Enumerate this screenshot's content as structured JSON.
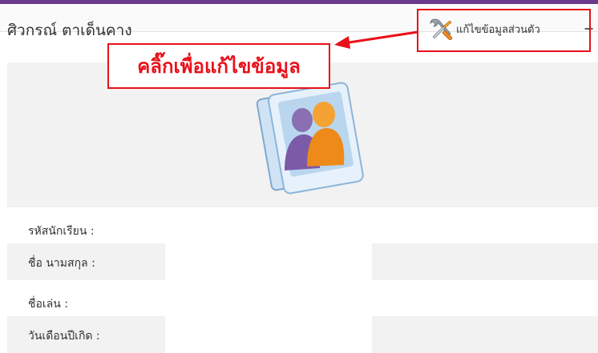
{
  "header": {
    "student_name": "ศิวกรณ์ ตาเด็นคาง",
    "edit_label": "แก้ไขข้อมูลส่วนตัว",
    "collapse_symbol": "−"
  },
  "profile": {
    "photo_icon": "user-photo-icon"
  },
  "fields": [
    {
      "label": "รหัสนักเรียน :",
      "value": ""
    },
    {
      "label": "ชื่อ นามสกุล :",
      "value": ""
    },
    {
      "label": "ชื่อเล่น :",
      "value": ""
    },
    {
      "label": "วันเดือนปีเกิด :",
      "value": ""
    }
  ],
  "annotation": {
    "text": "คลิ๊กเพื่อแก้ไขข้อมูล",
    "color": "#e8101a"
  },
  "colors": {
    "topbar": "#6b3a8a",
    "row_shade": "#f2f2f2"
  }
}
